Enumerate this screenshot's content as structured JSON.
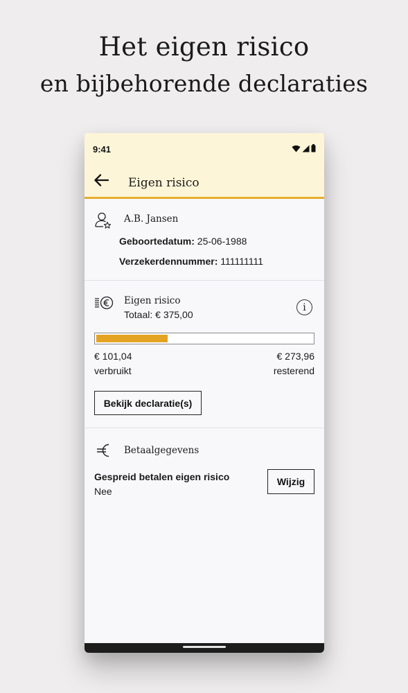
{
  "promo": {
    "title": "Het eigen risico",
    "subtitle": "en bijbehorende declaraties"
  },
  "status_bar": {
    "time": "9:41",
    "icons": [
      "wifi-icon",
      "signal-icon",
      "battery-icon"
    ]
  },
  "app_bar": {
    "back_icon": "arrow-left-icon",
    "title": "Eigen risico"
  },
  "person": {
    "icon": "user-star-icon",
    "name": "A.B. Jansen",
    "birth_label": "Geboortedatum:",
    "birth_value": "25-06-1988",
    "insured_label": "Verzekerdennummer:",
    "insured_value": "111111111"
  },
  "deductible": {
    "icon": "euro-coins-icon",
    "title": "Eigen risico",
    "total": "Totaal: € 375,00",
    "info_icon": "info-icon",
    "info_glyph": "i",
    "used_fraction": 0.33,
    "used_amount": "€ 101,04",
    "used_label": "verbruikt",
    "remaining_amount": "€ 273,96",
    "remaining_label": "resterend",
    "view_button": "Bekijk declaratie(s)"
  },
  "payment": {
    "icon": "euro-icon",
    "title": "Betaalgegevens",
    "spread_label": "Gespreid betalen eigen risico",
    "spread_value": "Nee",
    "edit_button": "Wijzig"
  },
  "colors": {
    "accent": "#e4a323",
    "appbar_bg": "#fdf5d8",
    "appbar_border": "#e6ad2c"
  }
}
